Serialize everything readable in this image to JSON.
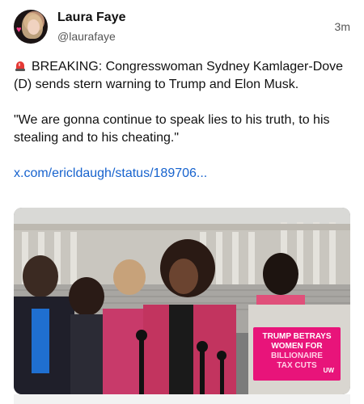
{
  "author": {
    "display_name": "Laura Faye",
    "handle": "@laurafaye",
    "timestamp": "3m"
  },
  "post": {
    "siren_icon": "siren-icon",
    "line1": "BREAKING: Congresswoman Sydney Kamlager-Dove (D) sends stern warning to Trump and Elon Musk.",
    "line2": "\"We are gonna continue to speak lies to his truth, to his stealing and to his cheating.\"",
    "link_text": "x.com/ericldaugh/status/189706..."
  },
  "media": {
    "sign_lines": [
      "TRUMP BETRAYS",
      "WOMEN FOR",
      "BILLIONAIRE",
      "TAX CUTS"
    ],
    "sign_tag": "UW"
  },
  "colors": {
    "link": "#1763ce",
    "sign": "#e8147a"
  }
}
